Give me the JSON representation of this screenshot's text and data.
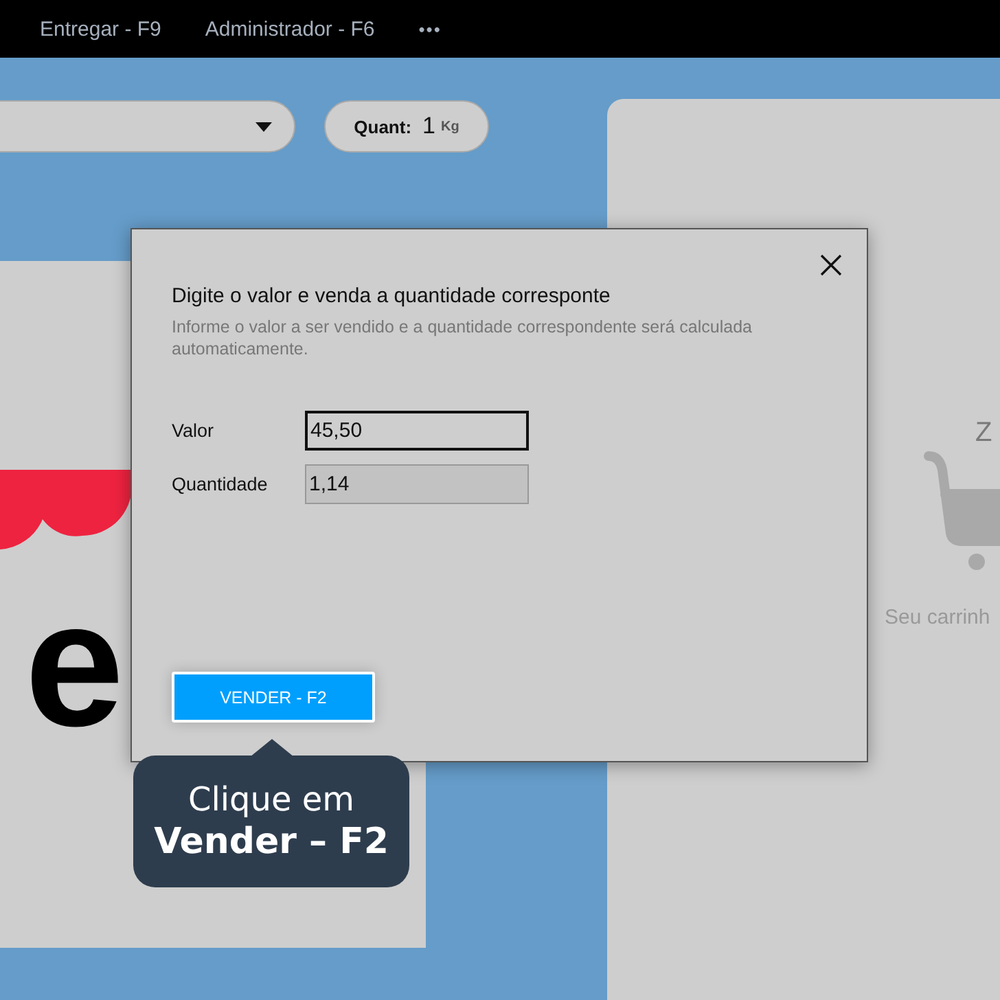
{
  "topbar": {
    "items": [
      "Entregar - F9",
      "Administrador - F6"
    ],
    "more": "•••"
  },
  "quant": {
    "label": "Quant:",
    "value": "1",
    "unit": "Kg"
  },
  "logo": {
    "text": "e"
  },
  "cart": {
    "heading": "Z",
    "empty_text": "Seu carrinh"
  },
  "dialog": {
    "title": "Digite o valor e venda a quantidade corresponte",
    "description": "Informe o valor a ser vendido e a quantidade correspondente será calculada automaticamente.",
    "fields": [
      {
        "label": "Valor",
        "value": "45,50",
        "focused": true,
        "readonly": false
      },
      {
        "label": "Quantidade",
        "value": "1,14",
        "focused": false,
        "readonly": true
      }
    ],
    "button": "VENDER - F2"
  },
  "tooltip": {
    "line1": "Clique em",
    "line2": "Vender – F2"
  }
}
